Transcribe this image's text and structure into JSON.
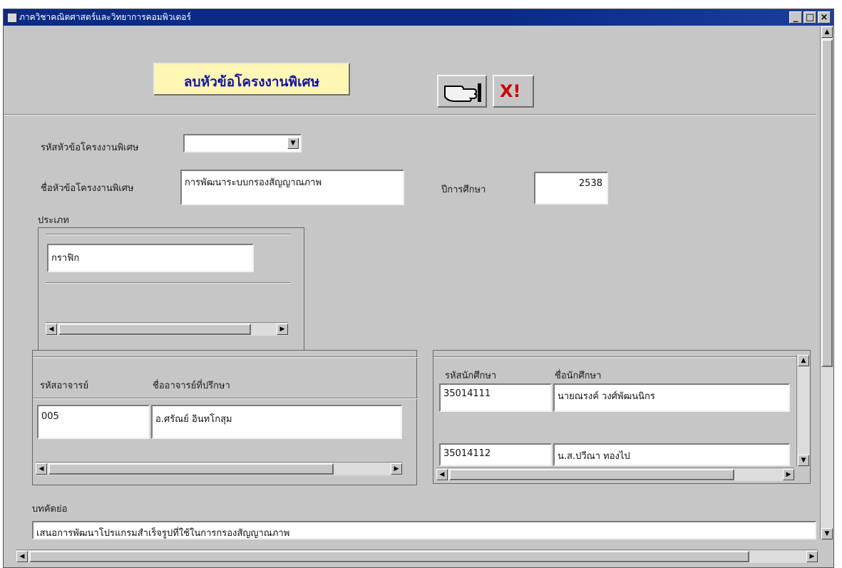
{
  "window": {
    "title": "ภาควิชาคณิตศาสตร์และวิทยาการคอมพิวเตอร์",
    "minimize": "_",
    "maximize": "□",
    "close": "×"
  },
  "header": {
    "title": "ลบหัวข้อโครงงานพิเศษ",
    "delete_symbol": "X!"
  },
  "form": {
    "project_code_label": "รหัสหัวข้อโครงงานพิเศษ",
    "project_code_value": "",
    "project_name_label": "ชื่อหัวข้อโครงงานพิเศษ",
    "project_name_value": "การพัฒนาระบบกรองสัญญาณภาพ",
    "year_label": "ปีการศึกษา",
    "year_value": "2538",
    "type_label": "ประเภท",
    "type_value": "กราฟิก",
    "abstract_label": "บทคัดย่อ",
    "abstract_value": "เสนอการพัฒนาโปรแกรมสำเร็จรูปที่ใช้ในการกรองสัญญาณภาพ"
  },
  "advisor": {
    "col_code": "รหัสอาจารย์",
    "col_name": "ชื่ออาจารย์ที่ปรึกษา",
    "rows": [
      {
        "code": "005",
        "name": "อ.ศรัณย์ อินทโกสุม"
      }
    ]
  },
  "students": {
    "col_id": "รหัสนักศึกษา",
    "col_name": "ชื่อนักศึกษา",
    "rows": [
      {
        "id": "35014111",
        "name": "นายณรงค์ วงศ์พัฒนนิกร"
      },
      {
        "id": "35014112",
        "name": "น.ส.ปวีณา ทองไป"
      }
    ]
  },
  "colors": {
    "title_bar": "#0a2a86",
    "window_bg": "#c6c6c6",
    "heading_bg": "#fdf6b4",
    "heading_text": "#1414a0",
    "delete_icon": "#cc0000"
  },
  "icons": {
    "hand": "hand-pointer-icon",
    "delete": "delete-x-icon",
    "dropdown": "chevron-down-icon"
  }
}
